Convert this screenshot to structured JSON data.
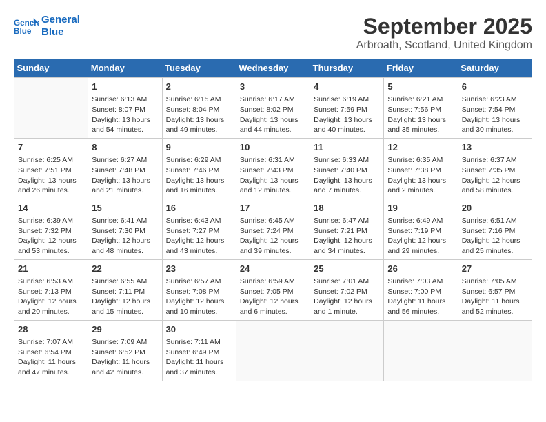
{
  "logo": {
    "line1": "General",
    "line2": "Blue"
  },
  "title": "September 2025",
  "subtitle": "Arbroath, Scotland, United Kingdom",
  "weekdays": [
    "Sunday",
    "Monday",
    "Tuesday",
    "Wednesday",
    "Thursday",
    "Friday",
    "Saturday"
  ],
  "weeks": [
    [
      {
        "day": "",
        "content": ""
      },
      {
        "day": "1",
        "content": "Sunrise: 6:13 AM\nSunset: 8:07 PM\nDaylight: 13 hours\nand 54 minutes."
      },
      {
        "day": "2",
        "content": "Sunrise: 6:15 AM\nSunset: 8:04 PM\nDaylight: 13 hours\nand 49 minutes."
      },
      {
        "day": "3",
        "content": "Sunrise: 6:17 AM\nSunset: 8:02 PM\nDaylight: 13 hours\nand 44 minutes."
      },
      {
        "day": "4",
        "content": "Sunrise: 6:19 AM\nSunset: 7:59 PM\nDaylight: 13 hours\nand 40 minutes."
      },
      {
        "day": "5",
        "content": "Sunrise: 6:21 AM\nSunset: 7:56 PM\nDaylight: 13 hours\nand 35 minutes."
      },
      {
        "day": "6",
        "content": "Sunrise: 6:23 AM\nSunset: 7:54 PM\nDaylight: 13 hours\nand 30 minutes."
      }
    ],
    [
      {
        "day": "7",
        "content": "Sunrise: 6:25 AM\nSunset: 7:51 PM\nDaylight: 13 hours\nand 26 minutes."
      },
      {
        "day": "8",
        "content": "Sunrise: 6:27 AM\nSunset: 7:48 PM\nDaylight: 13 hours\nand 21 minutes."
      },
      {
        "day": "9",
        "content": "Sunrise: 6:29 AM\nSunset: 7:46 PM\nDaylight: 13 hours\nand 16 minutes."
      },
      {
        "day": "10",
        "content": "Sunrise: 6:31 AM\nSunset: 7:43 PM\nDaylight: 13 hours\nand 12 minutes."
      },
      {
        "day": "11",
        "content": "Sunrise: 6:33 AM\nSunset: 7:40 PM\nDaylight: 13 hours\nand 7 minutes."
      },
      {
        "day": "12",
        "content": "Sunrise: 6:35 AM\nSunset: 7:38 PM\nDaylight: 13 hours\nand 2 minutes."
      },
      {
        "day": "13",
        "content": "Sunrise: 6:37 AM\nSunset: 7:35 PM\nDaylight: 12 hours\nand 58 minutes."
      }
    ],
    [
      {
        "day": "14",
        "content": "Sunrise: 6:39 AM\nSunset: 7:32 PM\nDaylight: 12 hours\nand 53 minutes."
      },
      {
        "day": "15",
        "content": "Sunrise: 6:41 AM\nSunset: 7:30 PM\nDaylight: 12 hours\nand 48 minutes."
      },
      {
        "day": "16",
        "content": "Sunrise: 6:43 AM\nSunset: 7:27 PM\nDaylight: 12 hours\nand 43 minutes."
      },
      {
        "day": "17",
        "content": "Sunrise: 6:45 AM\nSunset: 7:24 PM\nDaylight: 12 hours\nand 39 minutes."
      },
      {
        "day": "18",
        "content": "Sunrise: 6:47 AM\nSunset: 7:21 PM\nDaylight: 12 hours\nand 34 minutes."
      },
      {
        "day": "19",
        "content": "Sunrise: 6:49 AM\nSunset: 7:19 PM\nDaylight: 12 hours\nand 29 minutes."
      },
      {
        "day": "20",
        "content": "Sunrise: 6:51 AM\nSunset: 7:16 PM\nDaylight: 12 hours\nand 25 minutes."
      }
    ],
    [
      {
        "day": "21",
        "content": "Sunrise: 6:53 AM\nSunset: 7:13 PM\nDaylight: 12 hours\nand 20 minutes."
      },
      {
        "day": "22",
        "content": "Sunrise: 6:55 AM\nSunset: 7:11 PM\nDaylight: 12 hours\nand 15 minutes."
      },
      {
        "day": "23",
        "content": "Sunrise: 6:57 AM\nSunset: 7:08 PM\nDaylight: 12 hours\nand 10 minutes."
      },
      {
        "day": "24",
        "content": "Sunrise: 6:59 AM\nSunset: 7:05 PM\nDaylight: 12 hours\nand 6 minutes."
      },
      {
        "day": "25",
        "content": "Sunrise: 7:01 AM\nSunset: 7:02 PM\nDaylight: 12 hours\nand 1 minute."
      },
      {
        "day": "26",
        "content": "Sunrise: 7:03 AM\nSunset: 7:00 PM\nDaylight: 11 hours\nand 56 minutes."
      },
      {
        "day": "27",
        "content": "Sunrise: 7:05 AM\nSunset: 6:57 PM\nDaylight: 11 hours\nand 52 minutes."
      }
    ],
    [
      {
        "day": "28",
        "content": "Sunrise: 7:07 AM\nSunset: 6:54 PM\nDaylight: 11 hours\nand 47 minutes."
      },
      {
        "day": "29",
        "content": "Sunrise: 7:09 AM\nSunset: 6:52 PM\nDaylight: 11 hours\nand 42 minutes."
      },
      {
        "day": "30",
        "content": "Sunrise: 7:11 AM\nSunset: 6:49 PM\nDaylight: 11 hours\nand 37 minutes."
      },
      {
        "day": "",
        "content": ""
      },
      {
        "day": "",
        "content": ""
      },
      {
        "day": "",
        "content": ""
      },
      {
        "day": "",
        "content": ""
      }
    ]
  ]
}
